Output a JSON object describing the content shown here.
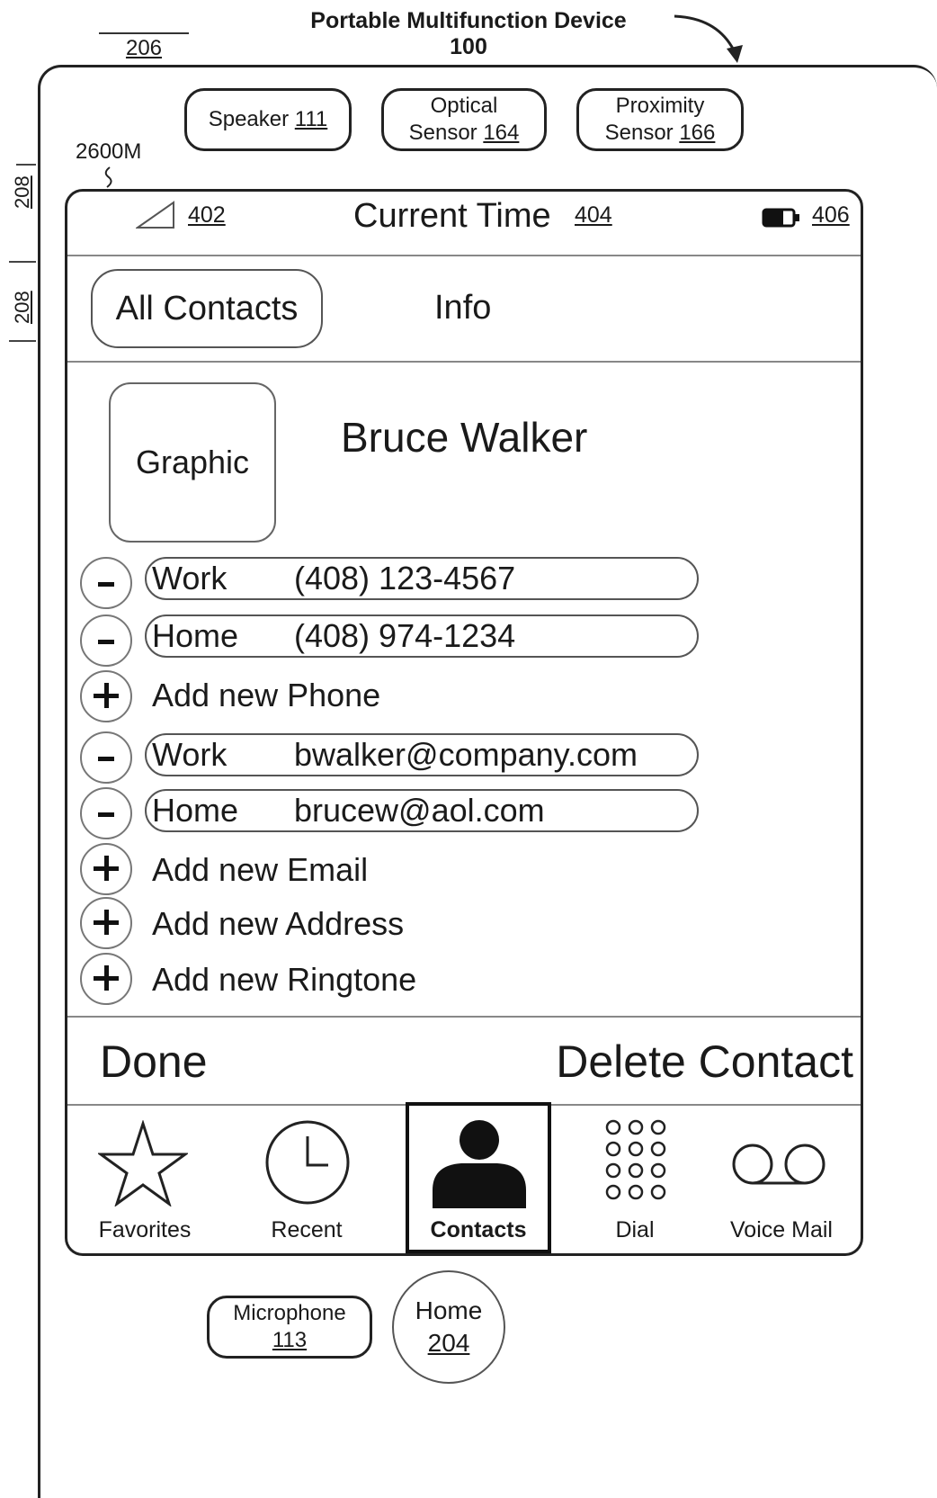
{
  "header": {
    "title": "Portable Multifunction Device",
    "device_ref": "100",
    "ref_206": "206",
    "ref_208_top": "208",
    "ref_208_bottom": "208",
    "screen_ref": "2600M"
  },
  "sensors": {
    "speaker_label": "Speaker",
    "speaker_ref": "111",
    "optical_line1": "Optical",
    "optical_line2": "Sensor",
    "optical_ref": "164",
    "proximity_line1": "Proximity",
    "proximity_line2": "Sensor",
    "proximity_ref": "166"
  },
  "status_bar": {
    "signal_ref": "402",
    "time_label": "Current Time",
    "time_ref": "404",
    "battery_ref": "406"
  },
  "nav": {
    "back_label": "All Contacts",
    "title": "Info"
  },
  "contact": {
    "graphic_label": "Graphic",
    "name": "Bruce Walker",
    "phones": [
      {
        "type": "Work",
        "value": "(408) 123-4567"
      },
      {
        "type": "Home",
        "value": "(408) 974-1234"
      }
    ],
    "add_phone": "Add new Phone",
    "emails": [
      {
        "type": "Work",
        "value": "bwalker@company.com"
      },
      {
        "type": "Home",
        "value": "brucew@aol.com"
      }
    ],
    "add_email": "Add new Email",
    "add_address": "Add new Address",
    "add_ringtone": "Add new Ringtone",
    "remove_symbol": "–",
    "add_symbol": "+"
  },
  "actions": {
    "done_label": "Done",
    "delete_label": "Delete Contact"
  },
  "tabs": [
    {
      "label": "Favorites",
      "icon": "star-icon"
    },
    {
      "label": "Recent",
      "icon": "clock-icon"
    },
    {
      "label": "Contacts",
      "icon": "person-icon",
      "selected": true
    },
    {
      "label": "Dial",
      "icon": "keypad-icon"
    },
    {
      "label": "Voice Mail",
      "icon": "voicemail-icon"
    }
  ],
  "hardware": {
    "microphone_label": "Microphone",
    "microphone_ref": "113",
    "home_label": "Home",
    "home_ref": "204"
  }
}
